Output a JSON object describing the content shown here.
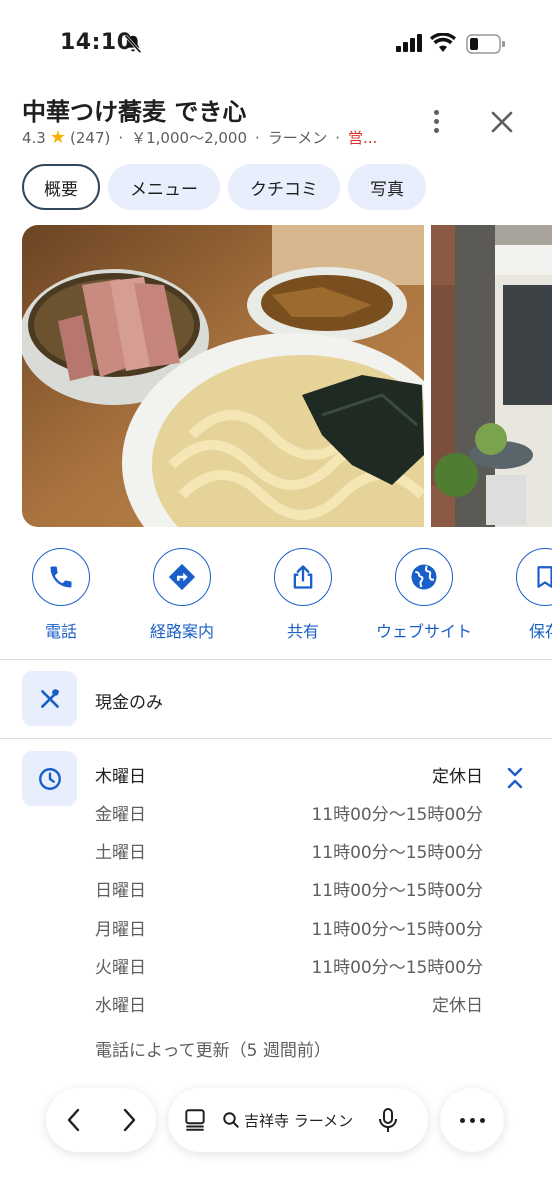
{
  "status_bar": {
    "time": "14:10"
  },
  "place": {
    "name": "中華つけ蕎麦 でき心",
    "rating": "4.3",
    "reviews": "(247)",
    "price": "￥1,000〜2,000",
    "category": "ラーメン",
    "open_status": "営..."
  },
  "tabs": [
    {
      "label": "概要"
    },
    {
      "label": "メニュー"
    },
    {
      "label": "クチコミ"
    },
    {
      "label": "写真"
    }
  ],
  "actions": [
    {
      "label": "電話",
      "icon": "phone-icon"
    },
    {
      "label": "経路案内",
      "icon": "directions-icon"
    },
    {
      "label": "共有",
      "icon": "share-icon"
    },
    {
      "label": "ウェブサイト",
      "icon": "globe-icon"
    },
    {
      "label": "保存",
      "icon": "bookmark-icon"
    }
  ],
  "payment": {
    "text": "現金のみ"
  },
  "hours": [
    {
      "day": "木曜日",
      "time": "定休日"
    },
    {
      "day": "金曜日",
      "time": "11時00分〜15時00分"
    },
    {
      "day": "土曜日",
      "time": "11時00分〜15時00分"
    },
    {
      "day": "日曜日",
      "time": "11時00分〜15時00分"
    },
    {
      "day": "月曜日",
      "time": "11時00分〜15時00分"
    },
    {
      "day": "火曜日",
      "time": "11時00分〜15時00分"
    },
    {
      "day": "水曜日",
      "time": "定休日"
    }
  ],
  "hours_updated": "電話によって更新（5 週間前）",
  "search": {
    "query": "吉祥寺 ラーメン"
  },
  "colors": {
    "accent": "#1a5fc9",
    "tab_bg": "#e8eefb",
    "star": "#f5b301",
    "closed_red": "#d93025"
  }
}
